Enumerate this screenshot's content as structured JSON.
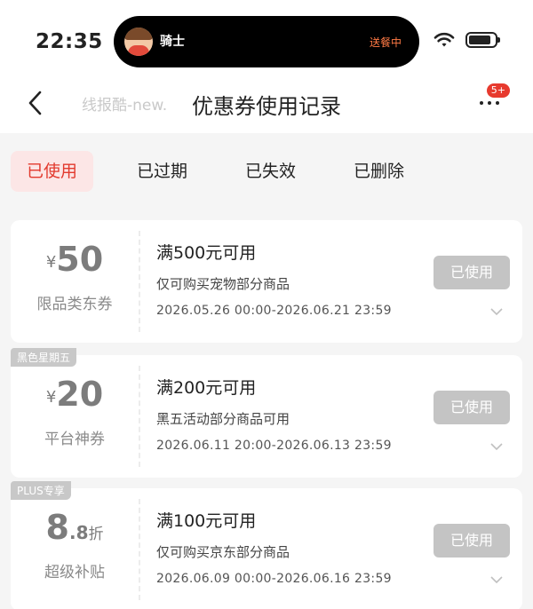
{
  "status_bar": {
    "time": "22:35",
    "island": {
      "name": "骑士",
      "status": "送餐中"
    },
    "battery_level": 0.85
  },
  "nav": {
    "watermark": "线报酷-new.",
    "title": "优惠券使用记录",
    "badge": "5+"
  },
  "tabs": [
    {
      "label": "已使用",
      "active": true
    },
    {
      "label": "已过期",
      "active": false
    },
    {
      "label": "已失效",
      "active": false
    },
    {
      "label": "已删除",
      "active": false
    }
  ],
  "coupons": [
    {
      "tag": "",
      "currency": "¥",
      "amount": "50",
      "amount_decimal": "",
      "amount_unit": "",
      "type_label": "限品类东券",
      "title": "满500元可用",
      "description": "仅可购买宠物部分商品",
      "validity": "2026.05.26 00:00-2026.06.21 23:59",
      "button_label": "已使用"
    },
    {
      "tag": "黑色星期五",
      "currency": "¥",
      "amount": "20",
      "amount_decimal": "",
      "amount_unit": "",
      "type_label": "平台神券",
      "title": "满200元可用",
      "description": "黑五活动部分商品可用",
      "validity": "2026.06.11 20:00-2026.06.13 23:59",
      "button_label": "已使用"
    },
    {
      "tag": "PLUS专享",
      "currency": "",
      "amount": "8",
      "amount_decimal": ".8",
      "amount_unit": "折",
      "type_label": "超级补贴",
      "title": "满100元可用",
      "description": "仅可购买京东部分商品",
      "validity": "2026.06.09 00:00-2026.06.16 23:59",
      "button_label": "已使用"
    }
  ],
  "colors": {
    "accent": "#e23a2e",
    "active_tab_bg": "#fce6e6",
    "used_button": "#c4c4c4",
    "island_status": "#ff7a45"
  }
}
